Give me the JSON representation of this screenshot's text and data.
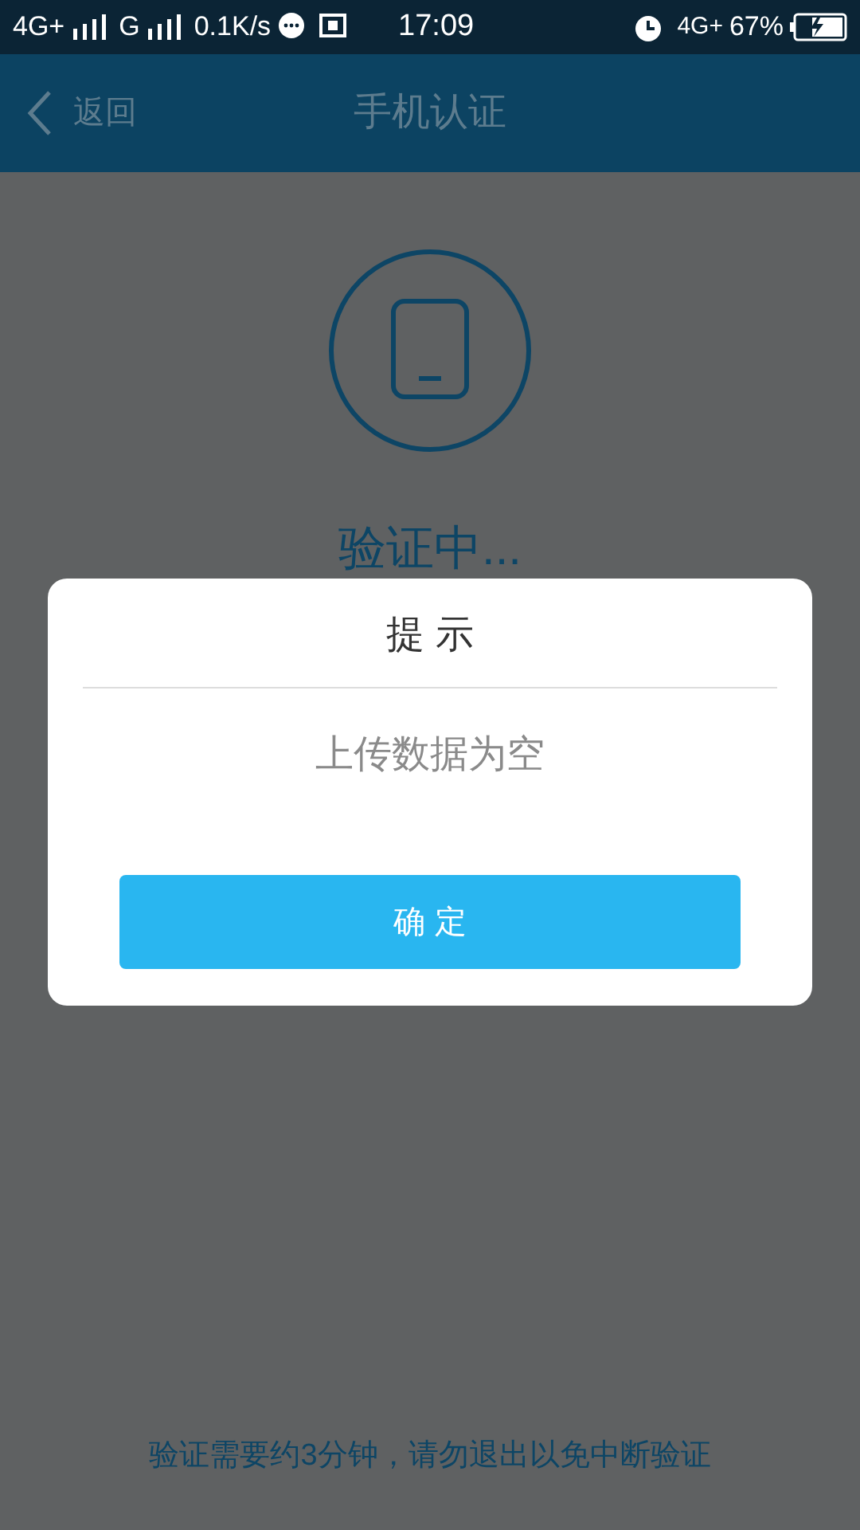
{
  "status_bar": {
    "network_1": "4G+",
    "network_2": "G",
    "speed": "0.1K/s",
    "time": "17:09",
    "network_3": "4G+",
    "battery": "67%"
  },
  "header": {
    "back": "返回",
    "title": "手机认证"
  },
  "status_text": "验证中...",
  "dialog": {
    "title": "提 示",
    "message": "上传数据为空",
    "button": "确 定"
  },
  "footer_note": "验证需要约3分钟，请勿退出以免中断验证"
}
